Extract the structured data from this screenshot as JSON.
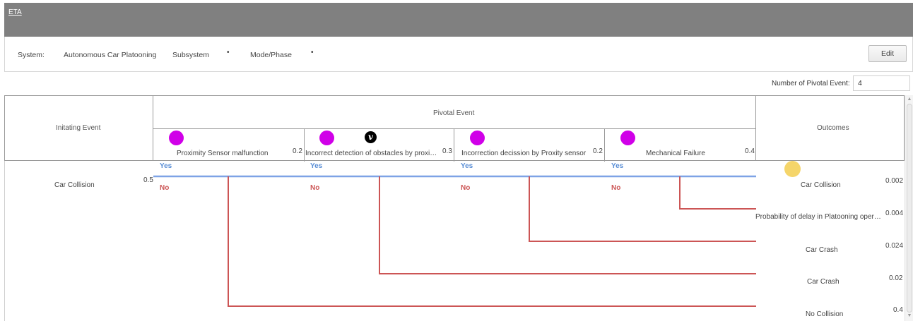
{
  "app": {
    "title": "ETA"
  },
  "system_bar": {
    "system_label": "System:",
    "system_value": "Autonomous Car Platooning",
    "subsystem_label": "Subsystem",
    "subsystem_value": "•",
    "mode_label": "Mode/Phase",
    "mode_value": "•",
    "edit_label": "Edit"
  },
  "pivot_count": {
    "label": "Number of Pivotal Event:",
    "value": "4"
  },
  "table": {
    "initiating_header": "Initating Event",
    "pivotal_header": "Pivotal Event",
    "outcomes_header": "Outcomes"
  },
  "pivotal_events": [
    {
      "name": "Proximity Sensor malfunction",
      "prob": "0.2",
      "icon": "purple-circle"
    },
    {
      "name": "Incorrect detection of obstacles by proximity sensor",
      "prob": "0.3",
      "icon": "purple-circle"
    },
    {
      "name": "Incorrection decission by Proxity sensor",
      "prob": "0.2",
      "icon": "purple-circle"
    },
    {
      "name": "Mechanical Failure",
      "prob": "0.4",
      "icon": "purple-circle"
    }
  ],
  "initiating_event": {
    "name": "Car Collision",
    "prob": "0.5"
  },
  "branch_labels": {
    "yes": "Yes",
    "no": "No"
  },
  "outcomes": [
    {
      "name": "Car Collision",
      "prob": "0.002"
    },
    {
      "name": "Probability of delay in Platooning operation",
      "prob": "0.004"
    },
    {
      "name": "Car Crash",
      "prob": "0.024"
    },
    {
      "name": "Car Crash",
      "prob": "0.02"
    },
    {
      "name": "No Collision",
      "prob": "0.4"
    }
  ],
  "colors": {
    "yes": "#5b8fd6",
    "no": "#cc5555",
    "pivot_dot": "#d000e8",
    "outcome_dot": "#f5d56a",
    "titlebar": "#808080"
  }
}
